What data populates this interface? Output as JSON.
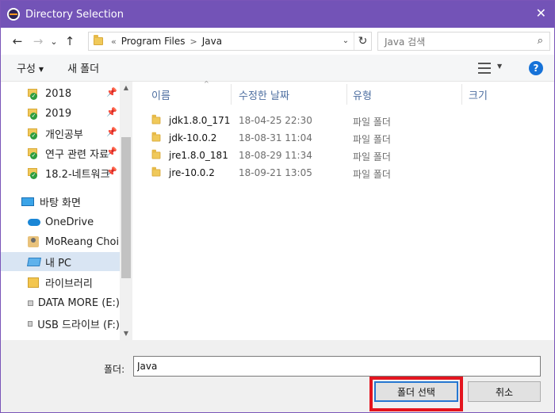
{
  "window": {
    "title": "Directory Selection",
    "close_glyph": "✕"
  },
  "nav": {
    "back_glyph": "←",
    "forward_glyph": "→",
    "recent_glyph": "⌄",
    "up_glyph": "↑",
    "breadcrumb_prefix": "«",
    "breadcrumb": [
      "Program Files",
      "Java"
    ],
    "breadcrumb_sep": ">",
    "refresh_glyph": "↻",
    "search_placeholder": "Java 검색",
    "search_icon": "search-icon"
  },
  "toolbar": {
    "organize": "구성",
    "new_folder": "새 폴더",
    "caret": "▼",
    "help": "?"
  },
  "sidebar": {
    "quick_access": [
      {
        "label": "2018",
        "pinned": true
      },
      {
        "label": "2019",
        "pinned": true
      },
      {
        "label": "개인공부",
        "pinned": true
      },
      {
        "label": "연구 관련 자료",
        "pinned": true
      },
      {
        "label": "18.2-네트워크",
        "pinned": true
      }
    ],
    "pin_glyph": "📌",
    "desktop": "바탕 화면",
    "onedrive": "OneDrive",
    "user": "MoReang Choi",
    "this_pc": "내 PC",
    "libraries": "라이브러리",
    "drive1": "DATA MORE (E:)",
    "drive2": "USB 드라이브 (F:)",
    "scroll_up": "▲",
    "scroll_down": "▼"
  },
  "columns": {
    "name": "이름",
    "date": "수정한 날짜",
    "type": "유형",
    "size": "크기",
    "sort_caret": "^"
  },
  "files": [
    {
      "name": "jdk1.8.0_171",
      "date": "18-04-25 22:30",
      "type": "파일 폴더"
    },
    {
      "name": "jdk-10.0.2",
      "date": "18-08-31 11:04",
      "type": "파일 폴더"
    },
    {
      "name": "jre1.8.0_181",
      "date": "18-08-29 11:34",
      "type": "파일 폴더"
    },
    {
      "name": "jre-10.0.2",
      "date": "18-09-21 13:05",
      "type": "파일 폴더"
    }
  ],
  "footer": {
    "folder_label": "폴더:",
    "folder_value": "Java",
    "select_button": "폴더 선택",
    "cancel_button": "취소"
  },
  "colors": {
    "titlebar": "#7353b7",
    "highlight": "#e4151f",
    "accent": "#2677d1"
  }
}
